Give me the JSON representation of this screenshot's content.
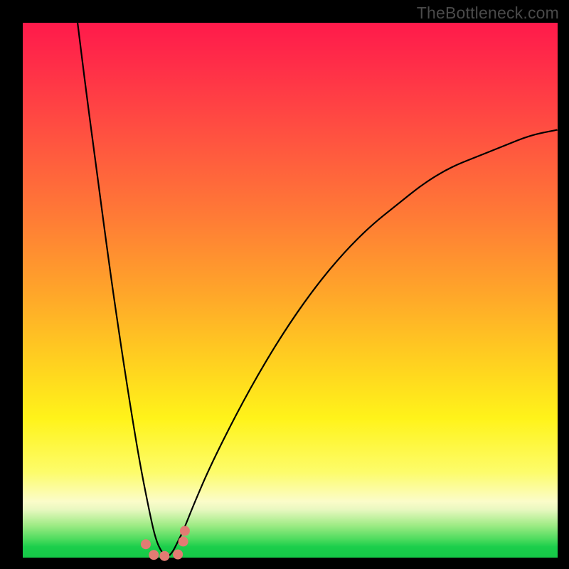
{
  "watermark": "TheBottleneck.com",
  "colors": {
    "marker": "#e37b73",
    "line": "#000000"
  },
  "chart_data": {
    "type": "line",
    "title": "",
    "xlabel": "",
    "ylabel": "",
    "xlim": [
      0,
      100
    ],
    "ylim": [
      0,
      100
    ],
    "series": [
      {
        "name": "left-branch",
        "x": [
          10,
          12,
          14,
          16,
          18,
          20,
          22,
          24,
          25,
          26,
          27
        ],
        "y": [
          102,
          86,
          71,
          56,
          42,
          29,
          17,
          7,
          3,
          1,
          0
        ]
      },
      {
        "name": "right-branch",
        "x": [
          27,
          28,
          29,
          30,
          32,
          35,
          40,
          45,
          50,
          55,
          60,
          65,
          70,
          75,
          80,
          85,
          90,
          95,
          100
        ],
        "y": [
          0,
          1,
          3,
          5,
          10,
          17,
          27,
          36,
          44,
          51,
          57,
          62,
          66,
          70,
          73,
          75,
          77,
          79,
          80
        ]
      }
    ],
    "markers": {
      "name": "highlight-points",
      "x": [
        23.0,
        24.5,
        26.5,
        29.0,
        30.0,
        30.3
      ],
      "y": [
        2.5,
        0.5,
        0.3,
        0.6,
        3.0,
        5.0
      ]
    },
    "minimum_x": 27
  }
}
